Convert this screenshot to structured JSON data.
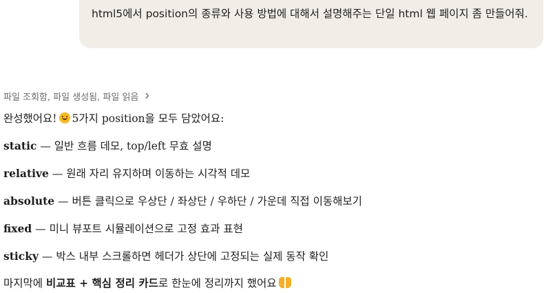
{
  "user_message": {
    "text": "html5에서 position의 종류와 사용 방법에 대해서 설명해주는 단일 html 웹 페이지 좀 만들어줘."
  },
  "tool_summary": {
    "label": "파일 조회함, 파일 생성됨, 파일 읽음",
    "icon": "chevron-right-icon"
  },
  "response": {
    "intro_before_emoji": "완성했어요!",
    "intro_emoji": "smiling-face-icon",
    "intro_after_emoji": "5가지 position을 모두 담았어요:",
    "items": [
      {
        "term": "static",
        "dash": " — ",
        "desc": "일반 흐름 데모, top/left 무효 설명"
      },
      {
        "term": "relative",
        "dash": " — ",
        "desc": "원래 자리 유지하며 이동하는 시각적 데모"
      },
      {
        "term": "absolute",
        "dash": " — ",
        "desc": "버튼 클릭으로 우상단 / 좌상단 / 우하단 / 가운데 직접 이동해보기"
      },
      {
        "term": "fixed",
        "dash": " — ",
        "desc": "미니 뷰포트 시뮬레이션으로 고정 효과 표현"
      },
      {
        "term": "sticky",
        "dash": " — ",
        "desc": "박스 내부 스크롤하면 헤더가 상단에 고정되는 실제 동작 확인"
      }
    ],
    "outro_before": "마지막에 ",
    "outro_bold": "비교표 + 핵심 정리 카드",
    "outro_after": "로 한눈에 정리까지 했어요",
    "outro_emoji": "raising-hands-icon"
  }
}
